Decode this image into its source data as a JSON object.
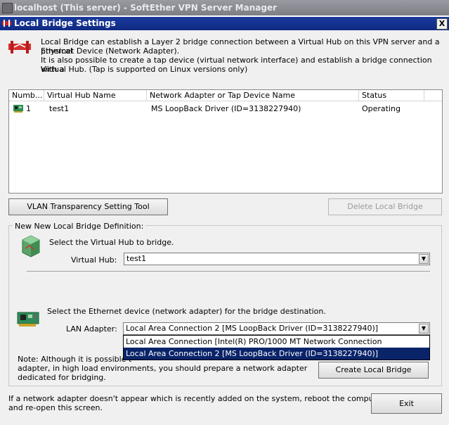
{
  "window": {
    "outer_title": "localhost (This server) - SoftEther VPN Server Manager",
    "inner_title": "Local Bridge Settings",
    "close_label": "X"
  },
  "description": {
    "line1": "Local Bridge can establish a Layer 2 bridge connection between a Virtual Hub on this VPN server and a physical",
    "line2": "Ethernet Device (Network Adapter).",
    "line3": "It is also possible to create a tap device (virtual network interface) and establish a bridge connection with a",
    "line4": "Virtual Hub. (Tap is supported on Linux versions only)"
  },
  "table": {
    "columns": [
      "Numb...",
      "Virtual Hub Name",
      "Network Adapter or Tap Device Name",
      "Status"
    ],
    "rows": [
      {
        "number": "1",
        "hub": "test1",
        "adapter": "MS LoopBack Driver (ID=3138227940)",
        "status": "Operating"
      }
    ]
  },
  "buttons": {
    "vlan_tool": "VLAN Transparency Setting Tool",
    "delete_bridge": "Delete Local Bridge",
    "create_bridge": "Create Local Bridge",
    "exit": "Exit"
  },
  "new_bridge": {
    "group_label": "New New Local Bridge Definition:",
    "hub_prompt": "Select the Virtual Hub to bridge.",
    "hub_label": "Virtual Hub:",
    "hub_value": "test1",
    "device_prompt": "Select the Ethernet device (network adapter) for the bridge destination.",
    "lan_label": "LAN Adapter:",
    "lan_value": "Local Area Connection 2 [MS LoopBack Driver (ID=3138227940)]",
    "options": [
      "Local Area Connection [Intel(R) PRO/1000 MT Network Connection (ID=3914566835)]",
      "Local Area Connection 2 [MS LoopBack Driver (ID=3138227940)]"
    ],
    "note_line1": "Note: Although it is possible t",
    "note_line2": "adapter, in high load environments, you should prepare a network adapter",
    "note_line3": "dedicated for bridging."
  },
  "footer": {
    "line1": "If a network adapter doesn't appear which is recently added on the system, reboot the computer",
    "line2": "and re-open this screen."
  },
  "colors": {
    "title_active": "#0f2a82",
    "selection": "#0a246a",
    "status_icon": "#2e8b57"
  }
}
